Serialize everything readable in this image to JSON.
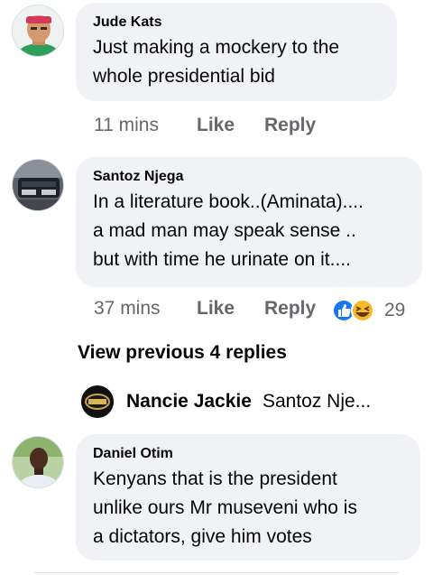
{
  "comments": [
    {
      "author": "Jude Kats",
      "text_lines": [
        "Just making a mockery to the",
        "whole presidential bid"
      ],
      "time": "11 mins",
      "like_label": "Like",
      "reply_label": "Reply"
    },
    {
      "author": "Santoz Njega",
      "text_lines": [
        "In a literature book..(Aminata)....",
        "a mad man may speak sense ..",
        "but with time he urinate on it...."
      ],
      "time": "37 mins",
      "like_label": "Like",
      "reply_label": "Reply",
      "reactions": {
        "icons": [
          "like-reaction-icon",
          "haha-reaction-icon"
        ],
        "count": "29"
      }
    },
    {
      "author": "Daniel Otim",
      "text_lines": [
        "Kenyans that is the president",
        "unlike ours Mr museveni who is",
        "a dictators,  give him votes"
      ]
    }
  ],
  "view_previous": "View previous 4 replies",
  "reply_preview": {
    "name": "Nancie Jackie",
    "snippet": "Santoz Nje..."
  },
  "colors": {
    "bubble": "#f0f2f5",
    "meta_text": "#65676b",
    "like_blue": "#1877f2",
    "haha_yellow": "#f7b928"
  }
}
